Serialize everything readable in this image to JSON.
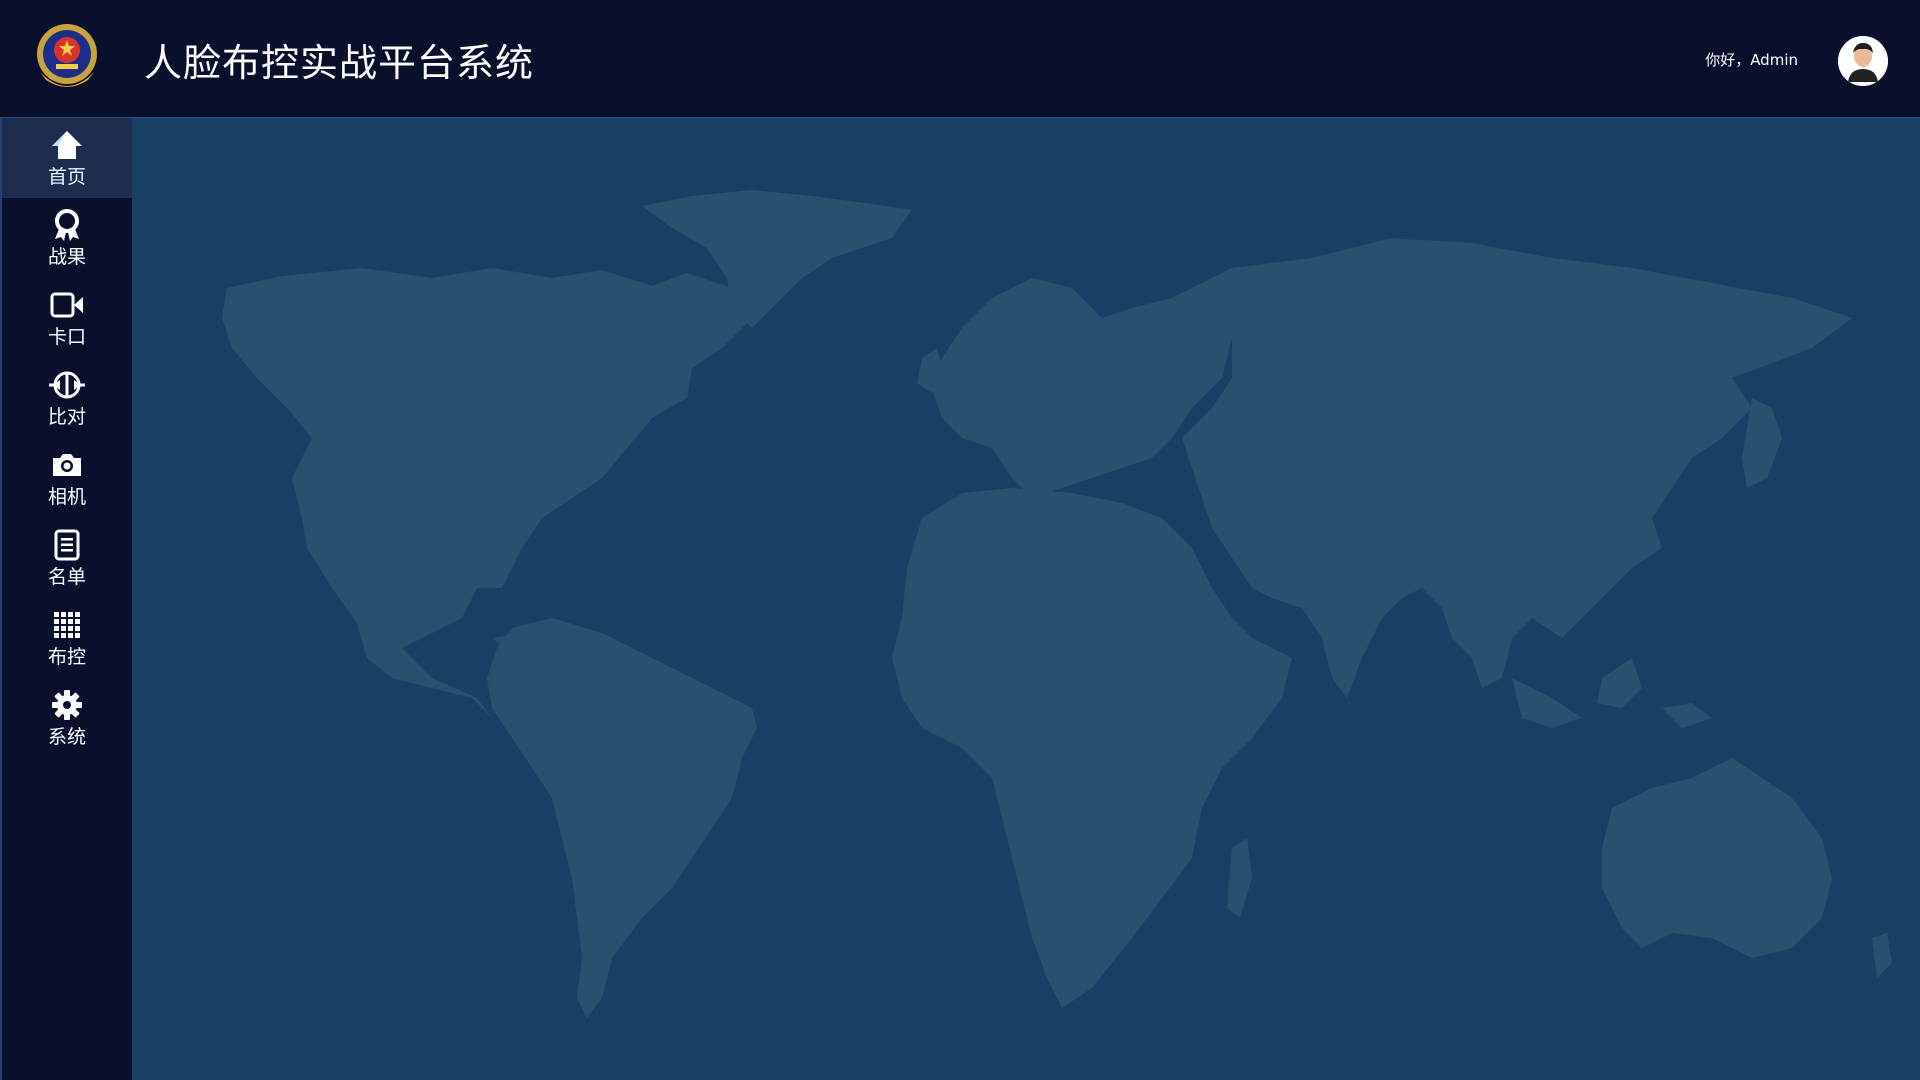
{
  "header": {
    "title": "人脸布控实战平台系统",
    "greeting": "你好，Admin",
    "emblem_icon": "police-emblem-icon",
    "avatar_icon": "user-avatar"
  },
  "sidebar": {
    "items": [
      {
        "label": "首页",
        "icon": "home-icon",
        "active": true
      },
      {
        "label": "战果",
        "icon": "award-icon",
        "active": false
      },
      {
        "label": "卡口",
        "icon": "video-camera-icon",
        "active": false
      },
      {
        "label": "比对",
        "icon": "compare-icon",
        "active": false
      },
      {
        "label": "相机",
        "icon": "camera-icon",
        "active": false
      },
      {
        "label": "名单",
        "icon": "document-icon",
        "active": false
      },
      {
        "label": "布控",
        "icon": "grid-icon",
        "active": false
      },
      {
        "label": "系统",
        "icon": "gear-icon",
        "active": false
      }
    ]
  },
  "main": {
    "background": "world-map"
  },
  "colors": {
    "header_bg": "#0a0f2b",
    "map_bg": "#1a3f64",
    "land": "#2a5070",
    "active_nav_bg": "#1e2d4d"
  }
}
